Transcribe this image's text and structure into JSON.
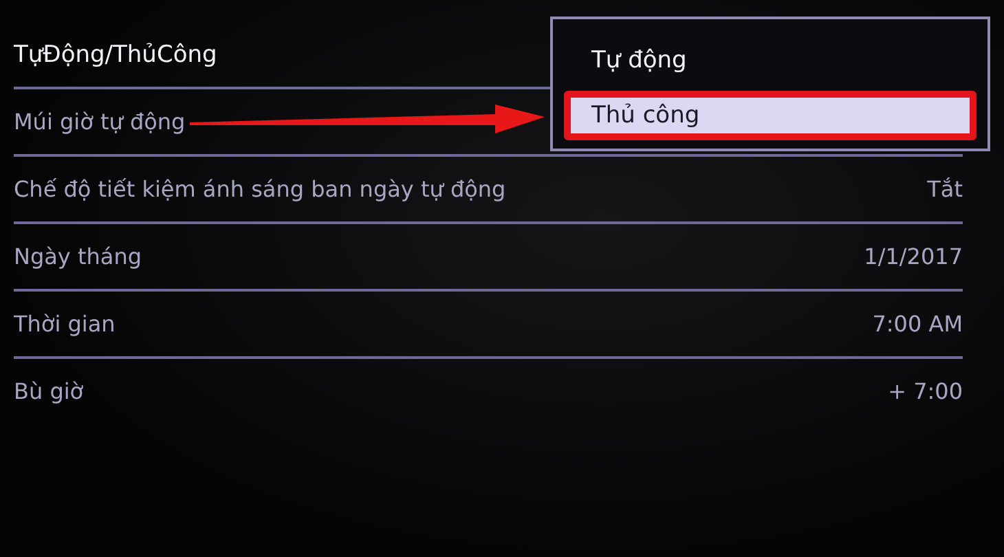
{
  "settings": [
    {
      "label": "TựĐộng/ThủCông",
      "focused": true
    },
    {
      "label": "Múi giờ tự động",
      "focused": false
    },
    {
      "label": "Chế độ tiết kiệm ánh sáng ban ngày tự động",
      "value": "Tắt",
      "focused": false
    },
    {
      "label": "Ngày tháng",
      "value": "1/1/2017",
      "focused": false
    },
    {
      "label": "Thời gian",
      "value": "7:00 AM",
      "focused": false
    },
    {
      "label": "Bù giờ",
      "value": "+ 7:00",
      "focused": false
    }
  ],
  "popup": {
    "options": [
      {
        "label": "Tự động",
        "selected": false
      },
      {
        "label": "Thủ công",
        "selected": true
      }
    ]
  }
}
